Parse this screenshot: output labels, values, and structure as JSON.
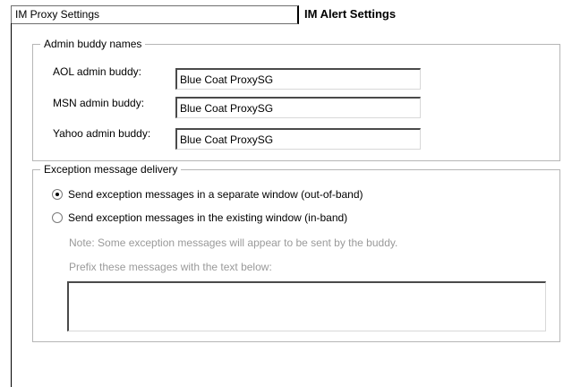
{
  "tabs": {
    "proxy_settings": "IM Proxy Settings",
    "alert_settings": "IM Alert Settings"
  },
  "admin_group": {
    "title": "Admin buddy names",
    "aol_label": "AOL admin buddy:",
    "aol_value": "Blue Coat ProxySG",
    "msn_label": "MSN admin buddy:",
    "msn_value": "Blue Coat ProxySG",
    "yahoo_label": "Yahoo admin buddy:",
    "yahoo_value": "Blue Coat ProxySG"
  },
  "exception_group": {
    "title": "Exception message delivery",
    "option_separate": "Send exception messages in a separate window (out-of-band)",
    "option_existing": "Send exception messages in the existing window (in-band)",
    "selected": "separate",
    "note": "Note: Some exception messages will appear to be sent by the buddy.",
    "prefix_label": "Prefix these messages with the text below:",
    "prefix_value": ""
  },
  "colors": {
    "disabled_text": "#9a9a9a",
    "group_border": "#b6b6b6"
  }
}
